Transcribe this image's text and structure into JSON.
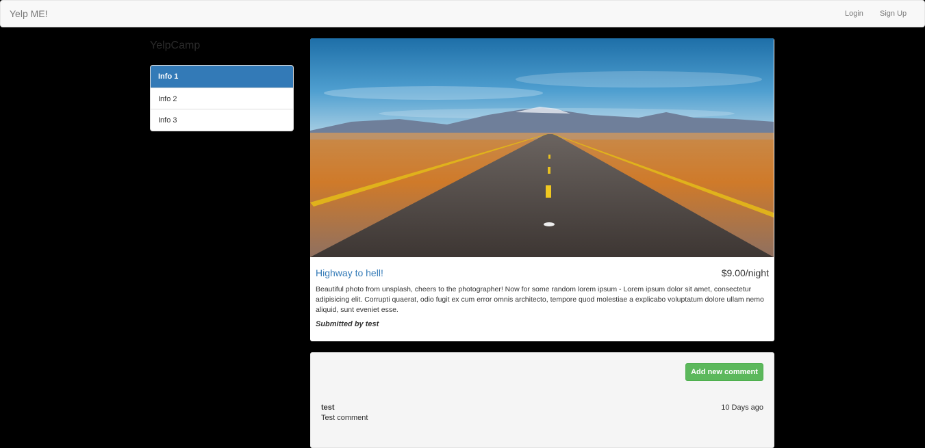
{
  "navbar": {
    "brand": "Yelp ME!",
    "login": "Login",
    "signup": "Sign Up"
  },
  "sidebar": {
    "title": "YelpCamp",
    "items": [
      {
        "label": "Info 1",
        "active": true
      },
      {
        "label": "Info 2",
        "active": false
      },
      {
        "label": "Info 3",
        "active": false
      }
    ]
  },
  "campground": {
    "image": "photo of a straight desert highway with yellow lines leading to mountains under blue sky",
    "title": "Highway to hell!",
    "price": "$9.00/night",
    "description": "Beautiful photo from unsplash, cheers to the photographer! Now for some random lorem ipsum - Lorem ipsum dolor sit amet, consectetur adipisicing elit. Corrupti quaerat, odio fugit ex cum error omnis architecto, tempore quod molestiae a explicabo voluptatum dolore ullam nemo aliquid, sunt eveniet esse.",
    "submitted": "Submitted by test"
  },
  "comments": {
    "add_button": "Add new comment",
    "items": [
      {
        "author": "test",
        "time": "10 Days ago",
        "text": "Test comment"
      }
    ]
  },
  "colors": {
    "primary": "#337ab7",
    "success": "#5cb85c",
    "navbar_bg": "#f8f8f8",
    "page_bg": "#000000"
  }
}
